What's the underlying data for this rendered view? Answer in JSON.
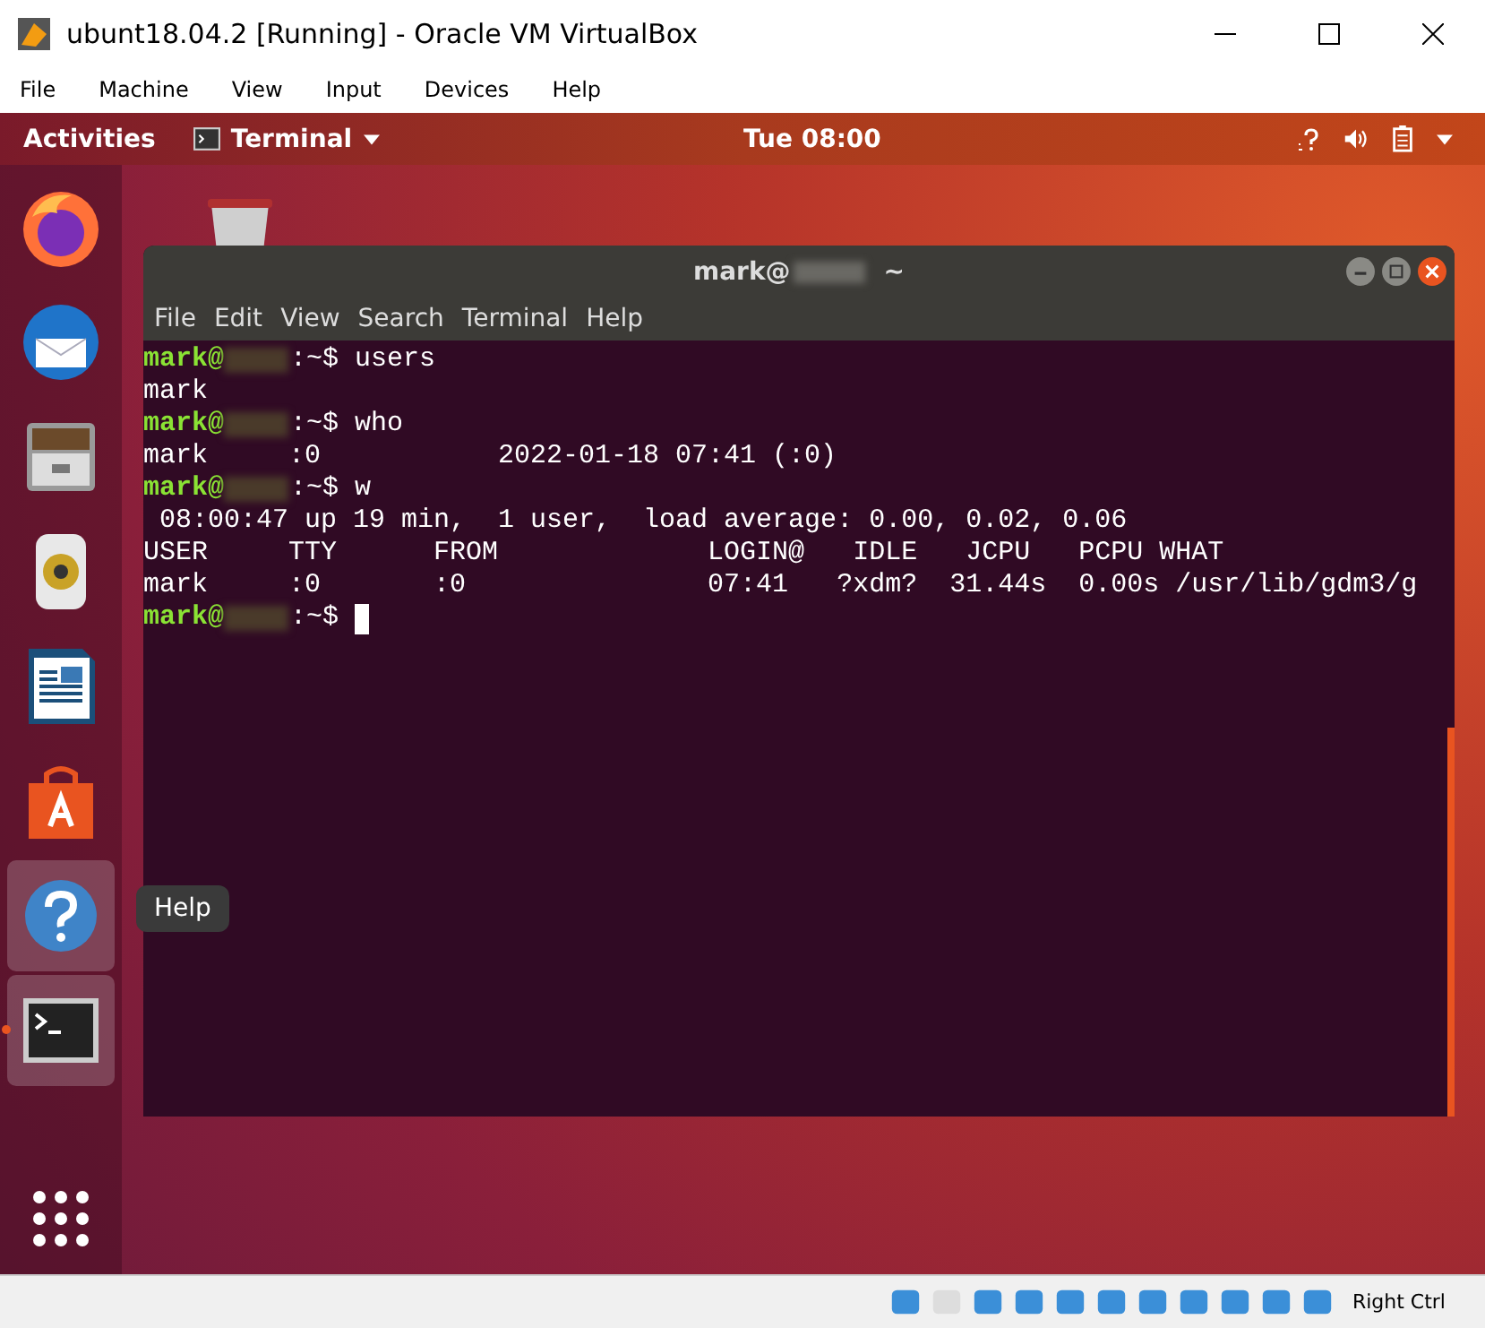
{
  "window": {
    "title": "ubunt18.04.2 [Running] - Oracle VM VirtualBox"
  },
  "menu": [
    "File",
    "Machine",
    "View",
    "Input",
    "Devices",
    "Help"
  ],
  "top_bar": {
    "activities": "Activities",
    "app_menu": "Terminal",
    "clock": "Tue 08:00"
  },
  "dock": {
    "items": [
      {
        "kind": "firefox",
        "highlighted": false,
        "running": false
      },
      {
        "kind": "mail",
        "highlighted": false,
        "running": false
      },
      {
        "kind": "files",
        "highlighted": false,
        "running": false
      },
      {
        "kind": "speaker",
        "highlighted": false,
        "running": false
      },
      {
        "kind": "writer",
        "highlighted": false,
        "running": false
      },
      {
        "kind": "software",
        "highlighted": false,
        "running": false
      },
      {
        "kind": "help",
        "highlighted": true,
        "running": false
      },
      {
        "kind": "terminal",
        "highlighted": true,
        "running": true
      }
    ],
    "tooltip": "Help"
  },
  "terminal": {
    "title_user": "mark@",
    "title_dir": "~",
    "menu": [
      "File",
      "Edit",
      "View",
      "Search",
      "Terminal",
      "Help"
    ],
    "lines": [
      {
        "kind": "prompt",
        "user": "mark@",
        "path": ":~$",
        "command": "users"
      },
      {
        "kind": "output",
        "text": "mark"
      },
      {
        "kind": "prompt",
        "user": "mark@",
        "path": ":~$",
        "command": "who"
      },
      {
        "kind": "output",
        "text": "mark     :0           2022-01-18 07:41 (:0)"
      },
      {
        "kind": "prompt",
        "user": "mark@",
        "path": ":~$",
        "command": "w"
      },
      {
        "kind": "output",
        "text": " 08:00:47 up 19 min,  1 user,  load average: 0.00, 0.02, 0.06"
      },
      {
        "kind": "output",
        "text": "USER     TTY      FROM             LOGIN@   IDLE   JCPU   PCPU WHAT"
      },
      {
        "kind": "output",
        "text": "mark     :0       :0               07:41   ?xdm?  31.44s  0.00s /usr/lib/gdm3/g"
      },
      {
        "kind": "prompt",
        "user": "mark@",
        "path": ":~$",
        "cursor": true
      }
    ]
  },
  "status_bar": {
    "host_key": "Right Ctrl"
  }
}
